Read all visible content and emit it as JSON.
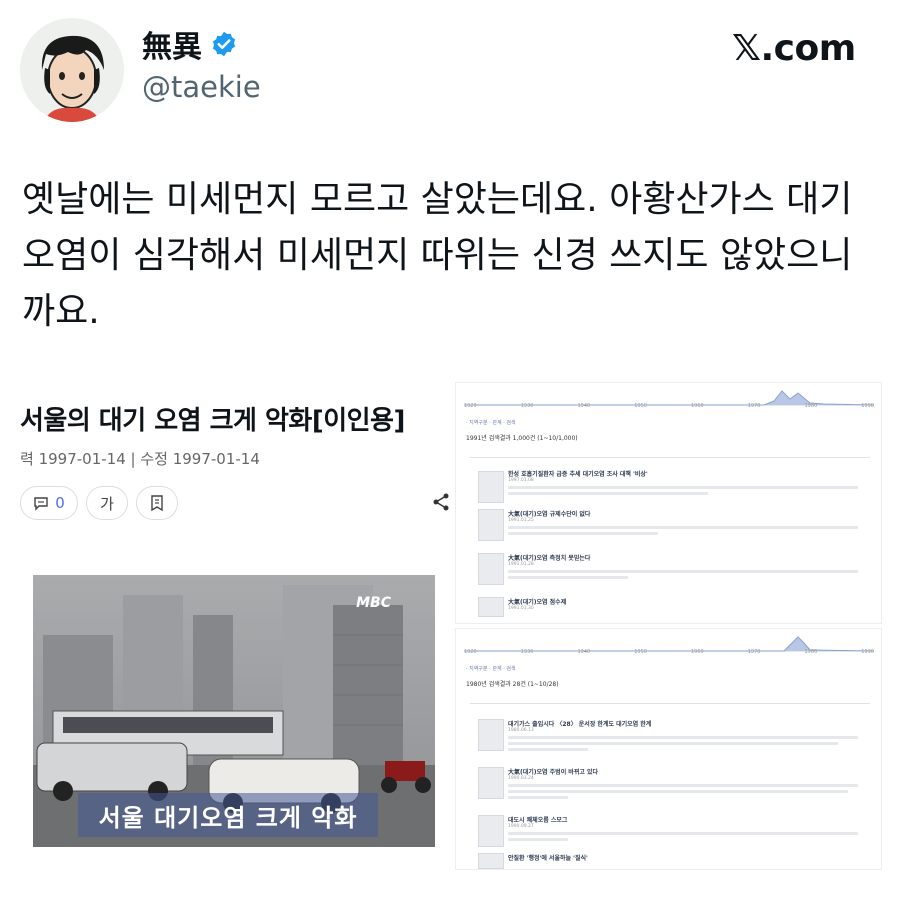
{
  "author": {
    "display_name": "無異",
    "handle": "@taekie",
    "verified": true
  },
  "brand": "𝕏.com",
  "tweet": {
    "text": "옛날에는 미세먼지 모르고 살았는데요. 아황산가스 대기 오염이 심각해서 미세먼지 따위는 신경 쓰지도 않았으니까요."
  },
  "news_screenshot": {
    "headline": "서울의 대기 오염 크게 악화[이인용]",
    "dates": "력 1997-01-14 | 수정 1997-01-14",
    "comment_count": "0",
    "font_button": "가",
    "video_caption": "서울 대기오염 크게 악화",
    "broadcaster": "MBC"
  },
  "search_screenshot": {
    "results_top": [
      {
        "title": "한성 호흡기질환자 급증 추세 대기오염 조사 대책 '비상'",
        "meta": "1997.01.08"
      },
      {
        "title": "大氣(대기)오염 규제수단이 없다",
        "meta": "1991.01.25"
      },
      {
        "title": "大氣(대기)오염 측정치 못믿는다",
        "meta": "1991.01.28"
      },
      {
        "title": "大氣(대기)오염 점수제",
        "meta": "1991.01.30"
      }
    ],
    "results_bottom": [
      {
        "title": "대기가스 출입시다 〈28〉 운서장 한계도 대기오염 한계",
        "meta": "1980.06.13"
      },
      {
        "title": "大氣(대기)오염 주범이 바뀌고 있다",
        "meta": "1990.03.24"
      },
      {
        "title": "대도시 쾌체오름 스모그",
        "meta": "1990.09.27"
      },
      {
        "title": "안질환 '행정'에 서울하늘 '질식'",
        "meta": "1990.10.02"
      }
    ],
    "count_label_top": "1991년 검색결과 1,000건 (1~10/1,000)",
    "count_label_bottom": "1980년 검색결과 28건 (1~10/28)"
  },
  "colors": {
    "verified": "#1d9bf0",
    "text": "#0f1419",
    "muted": "#536471"
  },
  "icons": [
    "verified-badge-icon",
    "comment-icon",
    "bookmark-icon",
    "share-icon"
  ]
}
